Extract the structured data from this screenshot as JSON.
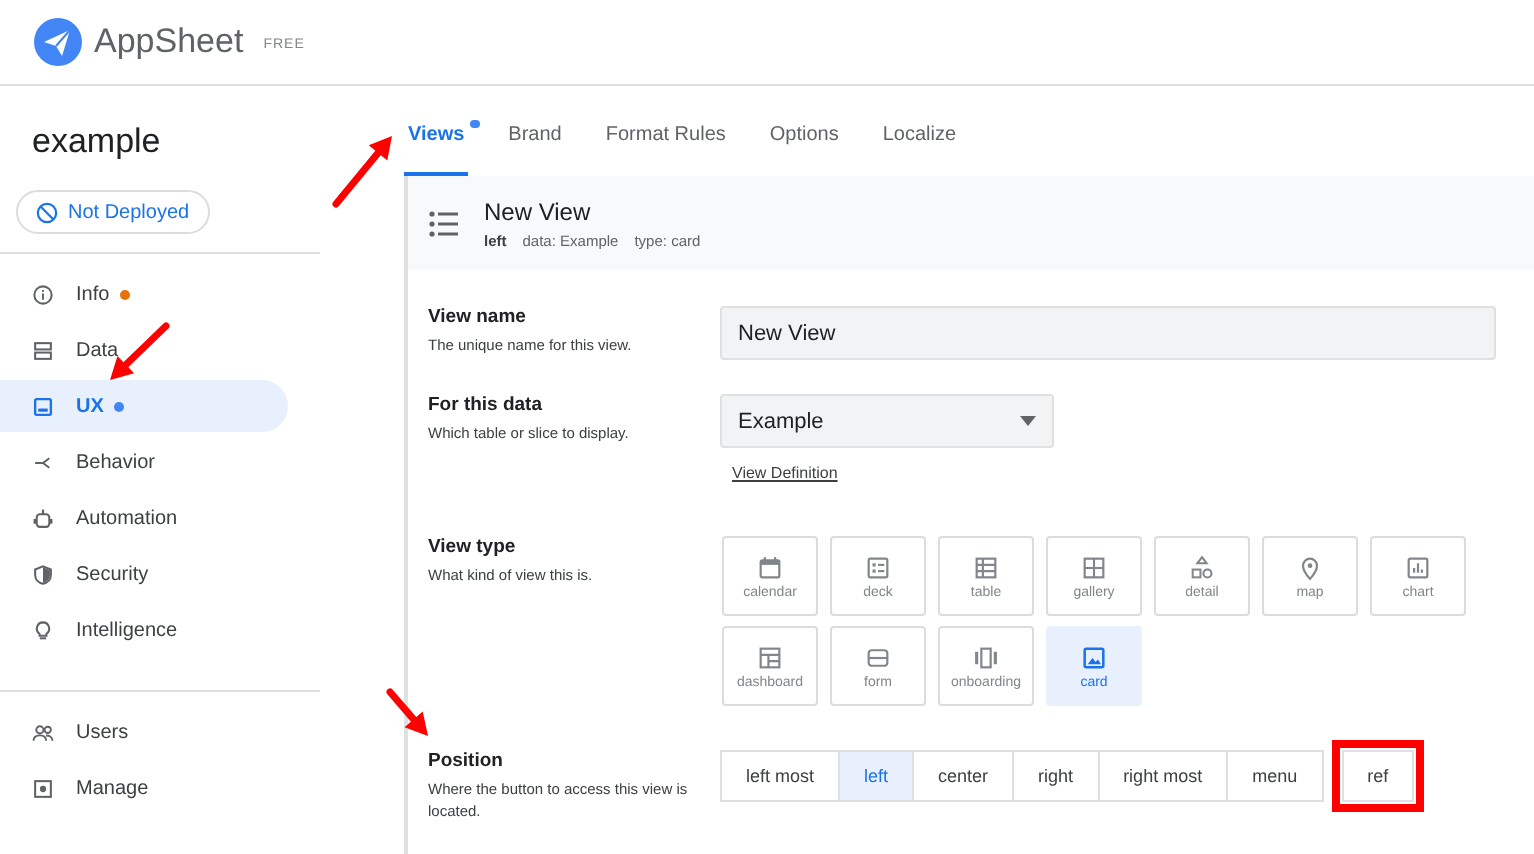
{
  "header": {
    "app_name": "AppSheet",
    "plan": "FREE"
  },
  "sidebar": {
    "app_title": "example",
    "deploy_status": "Not Deployed",
    "groups": [
      [
        {
          "label": "Info",
          "color": "#e8710a",
          "selected": false
        },
        {
          "label": "Data",
          "selected": false
        },
        {
          "label": "UX",
          "color": "#4285f4",
          "selected": true
        },
        {
          "label": "Behavior",
          "selected": false
        },
        {
          "label": "Automation",
          "selected": false
        },
        {
          "label": "Security",
          "selected": false
        },
        {
          "label": "Intelligence",
          "selected": false
        }
      ],
      [
        {
          "label": "Users",
          "selected": false
        },
        {
          "label": "Manage",
          "selected": false
        }
      ]
    ]
  },
  "tabs": [
    {
      "label": "Views",
      "selected": true,
      "color": "#4285f4"
    },
    {
      "label": "Brand",
      "selected": false
    },
    {
      "label": "Format Rules",
      "selected": false
    },
    {
      "label": "Options",
      "selected": false
    },
    {
      "label": "Localize",
      "selected": false
    }
  ],
  "view_header": {
    "title": "New View",
    "position": "left",
    "data_label": "data:",
    "data_value": "Example",
    "type_label": "type:",
    "type_value": "card"
  },
  "form": {
    "view_name": {
      "label": "View name",
      "hint": "The unique name for this view.",
      "value": "New View"
    },
    "for_this_data": {
      "label": "For this data",
      "hint": "Which table or slice to display.",
      "value": "Example",
      "link": "View Definition"
    },
    "view_type": {
      "label": "View type",
      "hint": "What kind of view this is.",
      "options": [
        {
          "label": "calendar",
          "selected": false
        },
        {
          "label": "deck",
          "selected": false
        },
        {
          "label": "table",
          "selected": false
        },
        {
          "label": "gallery",
          "selected": false
        },
        {
          "label": "detail",
          "selected": false
        },
        {
          "label": "map",
          "selected": false
        },
        {
          "label": "chart",
          "selected": false
        },
        {
          "label": "dashboard",
          "selected": false
        },
        {
          "label": "form",
          "selected": false
        },
        {
          "label": "onboarding",
          "selected": false
        },
        {
          "label": "card",
          "selected": true
        }
      ]
    },
    "position": {
      "label": "Position",
      "hint": "Where the button to access this view is located.",
      "options": [
        {
          "label": "left most",
          "selected": false,
          "highlighted": false
        },
        {
          "label": "left",
          "selected": true,
          "highlighted": false
        },
        {
          "label": "center",
          "selected": false,
          "highlighted": false
        },
        {
          "label": "right",
          "selected": false,
          "highlighted": false
        },
        {
          "label": "right most",
          "selected": false,
          "highlighted": false
        },
        {
          "label": "menu",
          "selected": false,
          "highlighted": false
        },
        {
          "label": "ref",
          "selected": false,
          "highlighted": true
        }
      ]
    }
  }
}
